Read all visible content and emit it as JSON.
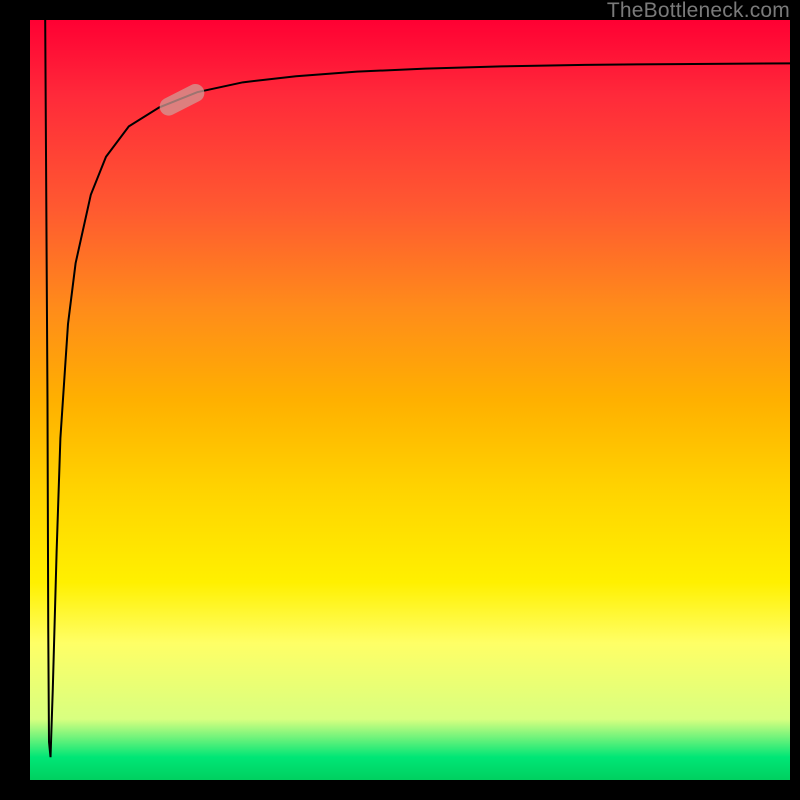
{
  "attribution": "TheBottleneck.com",
  "colors": {
    "frame": "#000000",
    "curve": "#000000",
    "marker": "rgba(210,155,150,0.75)",
    "gradient_top": "#ff0033",
    "gradient_bottom": "#00d060"
  },
  "chart_data": {
    "type": "line",
    "title": "",
    "xlabel": "",
    "ylabel": "",
    "xlim": [
      0,
      100
    ],
    "ylim": [
      0,
      100
    ],
    "grid": false,
    "legend": false,
    "series": [
      {
        "name": "curve",
        "x": [
          2.0,
          2.3,
          2.4,
          2.5,
          2.7,
          3.0,
          3.5,
          4.0,
          5.0,
          6.0,
          8.0,
          10.0,
          13.0,
          17.0,
          22.0,
          28.0,
          35.0,
          43.0,
          52.0,
          62.0,
          73.0,
          85.0,
          100.0
        ],
        "y": [
          100.0,
          50.0,
          20.0,
          5.0,
          3.0,
          12.0,
          30.0,
          45.0,
          60.0,
          68.0,
          77.0,
          82.0,
          86.0,
          88.5,
          90.5,
          91.8,
          92.6,
          93.2,
          93.6,
          93.9,
          94.1,
          94.2,
          94.3
        ]
      }
    ],
    "markers": [
      {
        "name": "highlight",
        "x": 20.0,
        "y": 89.5,
        "shape": "pill",
        "angle_deg": 27
      }
    ],
    "background_gradient_meaning": "red(top)=100=bad, green(bottom)=0=good"
  }
}
